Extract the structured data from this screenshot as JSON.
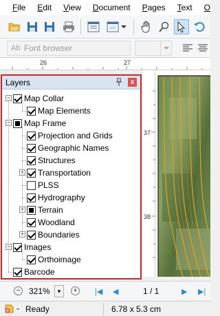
{
  "menu": {
    "items": [
      {
        "label": "File",
        "u": "F",
        "rest": "ile"
      },
      {
        "label": "Edit",
        "u": "E",
        "rest": "dit"
      },
      {
        "label": "View",
        "u": "V",
        "rest": "iew"
      },
      {
        "label": "Document",
        "u": "D",
        "rest": "ocument"
      },
      {
        "label": "Pages",
        "u": "P",
        "rest": "ages"
      },
      {
        "label": "Text",
        "u": "T",
        "rest": "ext"
      },
      {
        "label": "Object",
        "u": "O",
        "rest": "bject"
      }
    ]
  },
  "toolbar2": {
    "font_placeholder": "Font browser",
    "font_icon": "Ab"
  },
  "rulers": {
    "top_labels": [
      "26",
      "27"
    ],
    "left_labels": [
      "37",
      "38"
    ]
  },
  "layers": {
    "title": "Layers",
    "items": [
      {
        "label": "Map Collar",
        "state": "checked",
        "level": 0,
        "expander": "minus"
      },
      {
        "label": "Map Elements",
        "state": "checked",
        "level": 1,
        "expander": "none"
      },
      {
        "label": "Map Frame",
        "state": "partial",
        "level": 0,
        "expander": "minus"
      },
      {
        "label": "Projection and Grids",
        "state": "checked",
        "level": 1,
        "expander": "none"
      },
      {
        "label": "Geographic Names",
        "state": "checked",
        "level": 1,
        "expander": "none"
      },
      {
        "label": "Structures",
        "state": "checked",
        "level": 1,
        "expander": "none"
      },
      {
        "label": "Transportation",
        "state": "checked",
        "level": 1,
        "expander": "plus"
      },
      {
        "label": "PLSS",
        "state": "unchecked",
        "level": 1,
        "expander": "none"
      },
      {
        "label": "Hydrography",
        "state": "checked",
        "level": 1,
        "expander": "none"
      },
      {
        "label": "Terrain",
        "state": "partial",
        "level": 1,
        "expander": "plus"
      },
      {
        "label": "Woodland",
        "state": "checked",
        "level": 1,
        "expander": "none"
      },
      {
        "label": "Boundaries",
        "state": "checked",
        "level": 1,
        "expander": "plus"
      },
      {
        "label": "Images",
        "state": "checked",
        "level": 0,
        "expander": "minus"
      },
      {
        "label": "Orthoimage",
        "state": "checked",
        "level": 1,
        "expander": "none"
      },
      {
        "label": "Barcode",
        "state": "checked",
        "level": 0,
        "expander": "none"
      }
    ]
  },
  "bottombar": {
    "zoom": "321%",
    "page_indicator": "1 / 1"
  },
  "status": {
    "dash": "-",
    "text": "Ready",
    "dimensions": "6.78 x 5.3 cm"
  },
  "colors": {
    "accent_border": "#d2232a",
    "panel_header": "#d8e4f2",
    "nav_blue": "#2e88d6"
  }
}
